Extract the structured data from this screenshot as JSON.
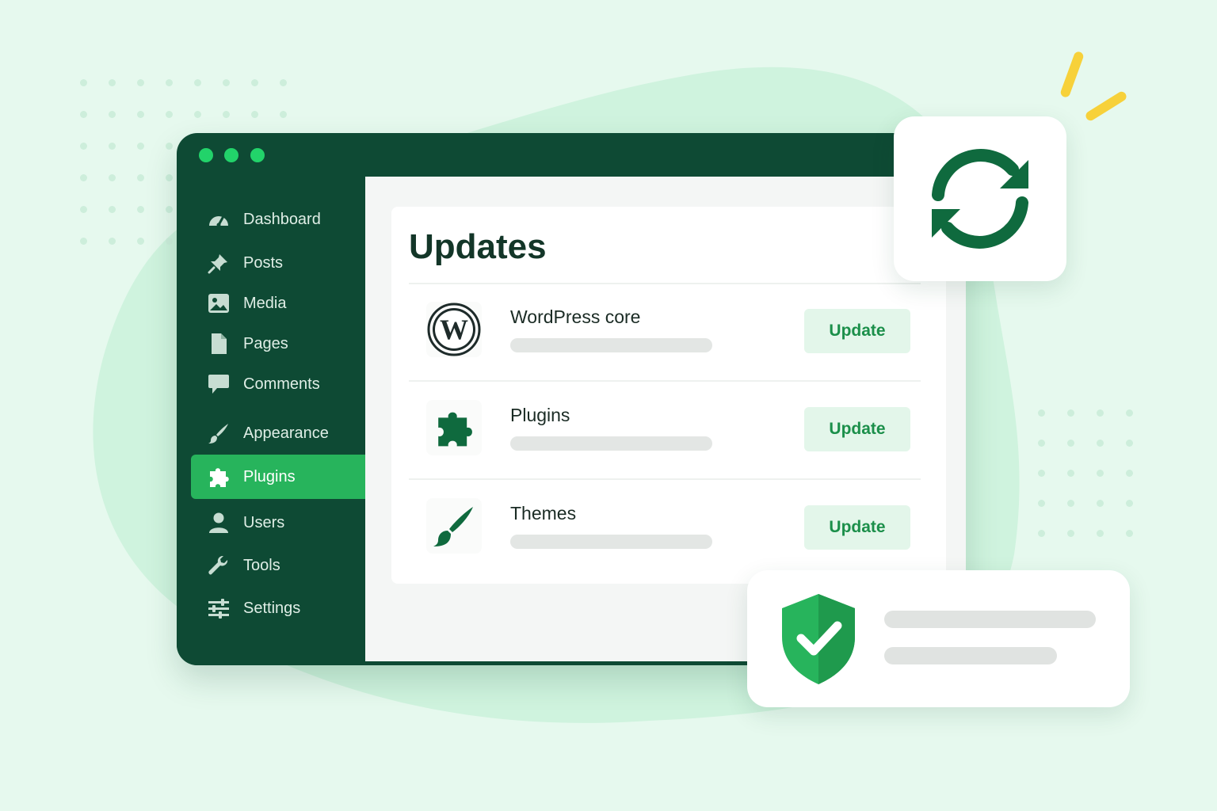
{
  "colors": {
    "background": "#e6f9ee",
    "sidebar": "#0e4a34",
    "accent": "#27b45c",
    "button_bg": "#e3f6ea",
    "button_text": "#1b8f4a",
    "spark": "#f7d13a"
  },
  "sidebar": {
    "items": [
      {
        "label": "Dashboard",
        "icon": "dashboard-icon"
      },
      {
        "label": "Posts",
        "icon": "pushpin-icon"
      },
      {
        "label": "Media",
        "icon": "media-icon"
      },
      {
        "label": "Pages",
        "icon": "page-icon"
      },
      {
        "label": "Comments",
        "icon": "comment-icon"
      },
      {
        "label": "Appearance",
        "icon": "brush-icon"
      },
      {
        "label": "Plugins",
        "icon": "plugin-icon",
        "active": true
      },
      {
        "label": "Users",
        "icon": "user-icon"
      },
      {
        "label": "Tools",
        "icon": "wrench-icon"
      },
      {
        "label": "Settings",
        "icon": "settings-sliders-icon"
      }
    ]
  },
  "main": {
    "title": "Updates",
    "rows": [
      {
        "label": "WordPress core",
        "icon": "wordpress-logo-icon",
        "button": "Update"
      },
      {
        "label": "Plugins",
        "icon": "plugin-icon",
        "button": "Update"
      },
      {
        "label": "Themes",
        "icon": "brush-icon",
        "button": "Update"
      }
    ]
  },
  "badges": {
    "sync": "sync-icon",
    "security": "shield-check-icon"
  }
}
